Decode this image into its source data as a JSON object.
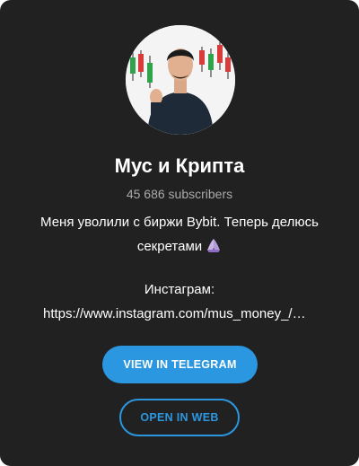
{
  "channel": {
    "name": "Мус и Крипта",
    "subscribers": "45 686 subscribers",
    "description_line1": "Меня уволили с биржи Bybit. Теперь делюсь",
    "description_line2": "секретами",
    "description_emoji": "praying-hands-icon",
    "instagram_label": "Инстаграм:",
    "instagram_link": "https://www.instagram.com/mus_money_/…"
  },
  "buttons": {
    "view_label": "VIEW IN TELEGRAM",
    "open_web_label": "OPEN IN WEB"
  },
  "colors": {
    "card_background": "#212121",
    "accent": "#2b97e0",
    "muted_text": "#aaaaaa"
  }
}
